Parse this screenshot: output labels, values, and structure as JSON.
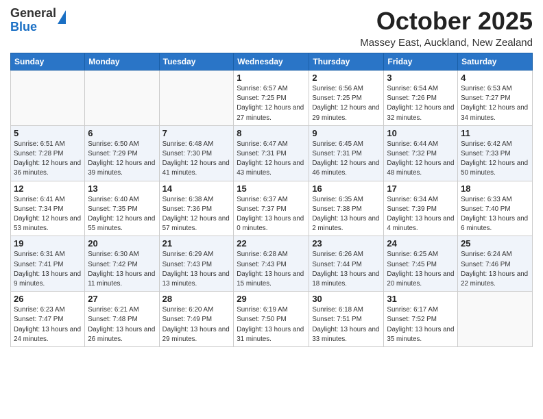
{
  "header": {
    "logo_general": "General",
    "logo_blue": "Blue",
    "month": "October 2025",
    "location": "Massey East, Auckland, New Zealand"
  },
  "weekdays": [
    "Sunday",
    "Monday",
    "Tuesday",
    "Wednesday",
    "Thursday",
    "Friday",
    "Saturday"
  ],
  "weeks": [
    [
      {
        "day": "",
        "sunrise": "",
        "sunset": "",
        "daylight": ""
      },
      {
        "day": "",
        "sunrise": "",
        "sunset": "",
        "daylight": ""
      },
      {
        "day": "",
        "sunrise": "",
        "sunset": "",
        "daylight": ""
      },
      {
        "day": "1",
        "sunrise": "Sunrise: 6:57 AM",
        "sunset": "Sunset: 7:25 PM",
        "daylight": "Daylight: 12 hours and 27 minutes."
      },
      {
        "day": "2",
        "sunrise": "Sunrise: 6:56 AM",
        "sunset": "Sunset: 7:25 PM",
        "daylight": "Daylight: 12 hours and 29 minutes."
      },
      {
        "day": "3",
        "sunrise": "Sunrise: 6:54 AM",
        "sunset": "Sunset: 7:26 PM",
        "daylight": "Daylight: 12 hours and 32 minutes."
      },
      {
        "day": "4",
        "sunrise": "Sunrise: 6:53 AM",
        "sunset": "Sunset: 7:27 PM",
        "daylight": "Daylight: 12 hours and 34 minutes."
      }
    ],
    [
      {
        "day": "5",
        "sunrise": "Sunrise: 6:51 AM",
        "sunset": "Sunset: 7:28 PM",
        "daylight": "Daylight: 12 hours and 36 minutes."
      },
      {
        "day": "6",
        "sunrise": "Sunrise: 6:50 AM",
        "sunset": "Sunset: 7:29 PM",
        "daylight": "Daylight: 12 hours and 39 minutes."
      },
      {
        "day": "7",
        "sunrise": "Sunrise: 6:48 AM",
        "sunset": "Sunset: 7:30 PM",
        "daylight": "Daylight: 12 hours and 41 minutes."
      },
      {
        "day": "8",
        "sunrise": "Sunrise: 6:47 AM",
        "sunset": "Sunset: 7:31 PM",
        "daylight": "Daylight: 12 hours and 43 minutes."
      },
      {
        "day": "9",
        "sunrise": "Sunrise: 6:45 AM",
        "sunset": "Sunset: 7:31 PM",
        "daylight": "Daylight: 12 hours and 46 minutes."
      },
      {
        "day": "10",
        "sunrise": "Sunrise: 6:44 AM",
        "sunset": "Sunset: 7:32 PM",
        "daylight": "Daylight: 12 hours and 48 minutes."
      },
      {
        "day": "11",
        "sunrise": "Sunrise: 6:42 AM",
        "sunset": "Sunset: 7:33 PM",
        "daylight": "Daylight: 12 hours and 50 minutes."
      }
    ],
    [
      {
        "day": "12",
        "sunrise": "Sunrise: 6:41 AM",
        "sunset": "Sunset: 7:34 PM",
        "daylight": "Daylight: 12 hours and 53 minutes."
      },
      {
        "day": "13",
        "sunrise": "Sunrise: 6:40 AM",
        "sunset": "Sunset: 7:35 PM",
        "daylight": "Daylight: 12 hours and 55 minutes."
      },
      {
        "day": "14",
        "sunrise": "Sunrise: 6:38 AM",
        "sunset": "Sunset: 7:36 PM",
        "daylight": "Daylight: 12 hours and 57 minutes."
      },
      {
        "day": "15",
        "sunrise": "Sunrise: 6:37 AM",
        "sunset": "Sunset: 7:37 PM",
        "daylight": "Daylight: 13 hours and 0 minutes."
      },
      {
        "day": "16",
        "sunrise": "Sunrise: 6:35 AM",
        "sunset": "Sunset: 7:38 PM",
        "daylight": "Daylight: 13 hours and 2 minutes."
      },
      {
        "day": "17",
        "sunrise": "Sunrise: 6:34 AM",
        "sunset": "Sunset: 7:39 PM",
        "daylight": "Daylight: 13 hours and 4 minutes."
      },
      {
        "day": "18",
        "sunrise": "Sunrise: 6:33 AM",
        "sunset": "Sunset: 7:40 PM",
        "daylight": "Daylight: 13 hours and 6 minutes."
      }
    ],
    [
      {
        "day": "19",
        "sunrise": "Sunrise: 6:31 AM",
        "sunset": "Sunset: 7:41 PM",
        "daylight": "Daylight: 13 hours and 9 minutes."
      },
      {
        "day": "20",
        "sunrise": "Sunrise: 6:30 AM",
        "sunset": "Sunset: 7:42 PM",
        "daylight": "Daylight: 13 hours and 11 minutes."
      },
      {
        "day": "21",
        "sunrise": "Sunrise: 6:29 AM",
        "sunset": "Sunset: 7:43 PM",
        "daylight": "Daylight: 13 hours and 13 minutes."
      },
      {
        "day": "22",
        "sunrise": "Sunrise: 6:28 AM",
        "sunset": "Sunset: 7:43 PM",
        "daylight": "Daylight: 13 hours and 15 minutes."
      },
      {
        "day": "23",
        "sunrise": "Sunrise: 6:26 AM",
        "sunset": "Sunset: 7:44 PM",
        "daylight": "Daylight: 13 hours and 18 minutes."
      },
      {
        "day": "24",
        "sunrise": "Sunrise: 6:25 AM",
        "sunset": "Sunset: 7:45 PM",
        "daylight": "Daylight: 13 hours and 20 minutes."
      },
      {
        "day": "25",
        "sunrise": "Sunrise: 6:24 AM",
        "sunset": "Sunset: 7:46 PM",
        "daylight": "Daylight: 13 hours and 22 minutes."
      }
    ],
    [
      {
        "day": "26",
        "sunrise": "Sunrise: 6:23 AM",
        "sunset": "Sunset: 7:47 PM",
        "daylight": "Daylight: 13 hours and 24 minutes."
      },
      {
        "day": "27",
        "sunrise": "Sunrise: 6:21 AM",
        "sunset": "Sunset: 7:48 PM",
        "daylight": "Daylight: 13 hours and 26 minutes."
      },
      {
        "day": "28",
        "sunrise": "Sunrise: 6:20 AM",
        "sunset": "Sunset: 7:49 PM",
        "daylight": "Daylight: 13 hours and 29 minutes."
      },
      {
        "day": "29",
        "sunrise": "Sunrise: 6:19 AM",
        "sunset": "Sunset: 7:50 PM",
        "daylight": "Daylight: 13 hours and 31 minutes."
      },
      {
        "day": "30",
        "sunrise": "Sunrise: 6:18 AM",
        "sunset": "Sunset: 7:51 PM",
        "daylight": "Daylight: 13 hours and 33 minutes."
      },
      {
        "day": "31",
        "sunrise": "Sunrise: 6:17 AM",
        "sunset": "Sunset: 7:52 PM",
        "daylight": "Daylight: 13 hours and 35 minutes."
      },
      {
        "day": "",
        "sunrise": "",
        "sunset": "",
        "daylight": ""
      }
    ]
  ]
}
